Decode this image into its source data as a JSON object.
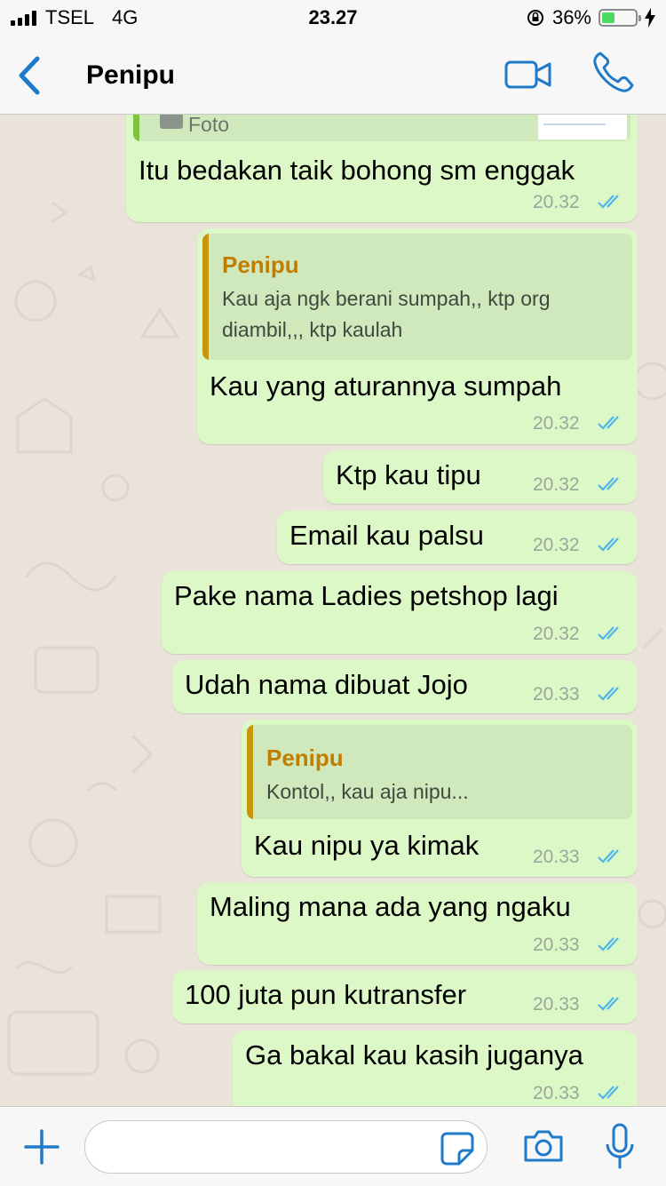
{
  "status_bar": {
    "carrier": "TSEL",
    "network": "4G",
    "time": "23.27",
    "battery_percent": "36%",
    "battery_level": 0.36
  },
  "header": {
    "contact_name": "Penipu",
    "back_icon": "chevron-left-icon",
    "video_icon": "video-camera-icon",
    "call_icon": "phone-icon"
  },
  "messages": [
    {
      "text": "Itu bedakan taik bohong sm enggak",
      "time": "20.32",
      "status": "read",
      "partial_quote_label": "Foto"
    },
    {
      "quote": {
        "author": "Penipu",
        "line1": "Kau aja ngk berani sumpah,,  ktp org",
        "line2": "diambil,,,  ktp kaulah"
      },
      "text": "Kau yang aturannya sumpah",
      "time": "20.32",
      "status": "read"
    },
    {
      "text": "Ktp kau tipu",
      "time": "20.32",
      "status": "read"
    },
    {
      "text": "Email kau palsu",
      "time": "20.32",
      "status": "read"
    },
    {
      "text": "Pake nama Ladies petshop lagi",
      "time": "20.32",
      "status": "read"
    },
    {
      "text": "Udah nama dibuat Jojo",
      "time": "20.33",
      "status": "read"
    },
    {
      "quote": {
        "author": "Penipu",
        "line1": "Kontol,,  kau aja nipu..."
      },
      "text": "Kau nipu ya kimak",
      "time": "20.33",
      "status": "read"
    },
    {
      "text": "Maling mana ada yang ngaku",
      "time": "20.33",
      "status": "read"
    },
    {
      "text": "100 juta pun kutransfer",
      "time": "20.33",
      "status": "read"
    },
    {
      "text": "Ga bakal kau kasih juganya",
      "time": "20.33",
      "status": "read"
    }
  ],
  "input_bar": {
    "placeholder": "",
    "plus_icon": "plus-icon",
    "sticker_icon": "sticker-icon",
    "camera_icon": "camera-icon",
    "mic_icon": "microphone-icon"
  },
  "colors": {
    "accent": "#1f7ac9",
    "outgoing_bubble": "#dcf8c6",
    "quote_bar": "#c7960b",
    "quote_author": "#c17d00",
    "read_ticks": "#4fb6ec",
    "chat_background": "#e9e3da"
  }
}
